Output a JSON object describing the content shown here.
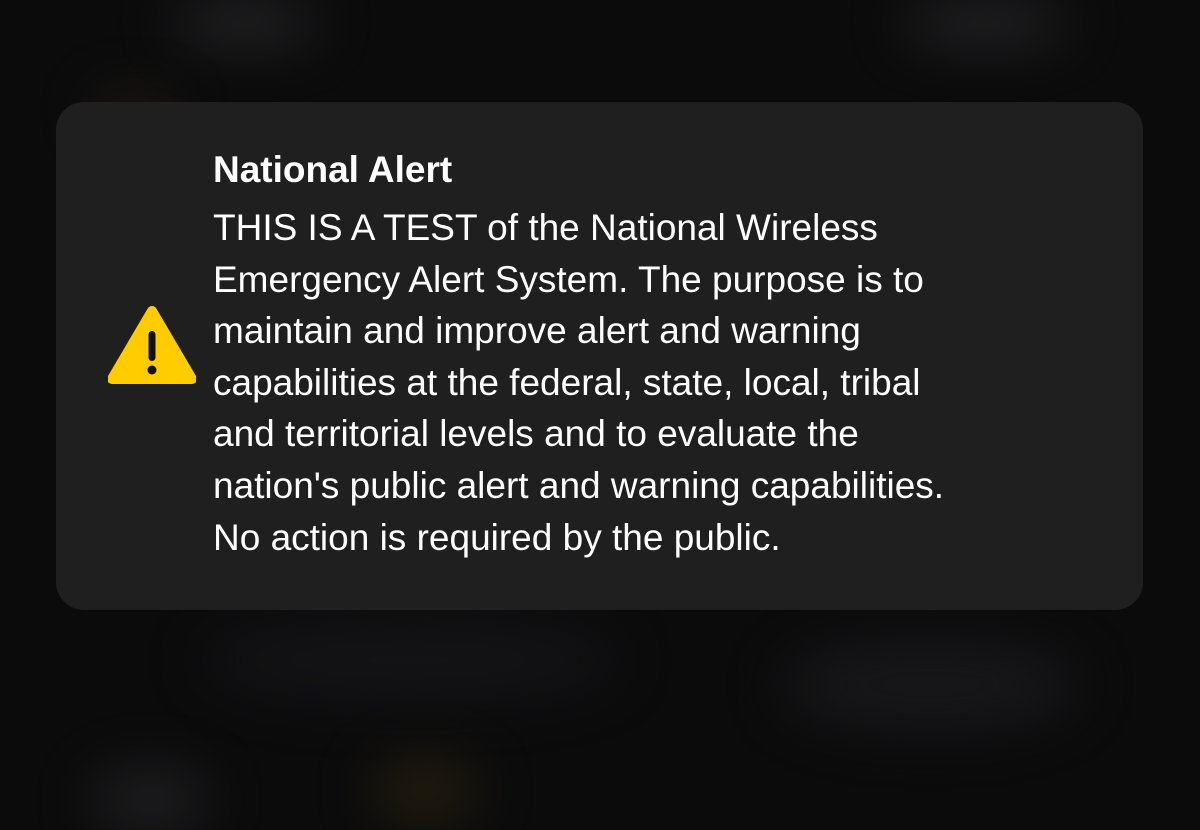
{
  "alert": {
    "icon": "warning-triangle-icon",
    "icon_color": "#FFCC00",
    "title": "National Alert",
    "body_lines": [
      "THIS IS A TEST of the National Wireless",
      "Emergency Alert System. The purpose is to",
      "maintain and improve alert and warning",
      "capabilities at the federal, state, local, tribal",
      "and territorial levels and to evaluate the",
      "nation's public alert and warning capabilities.",
      "No action is required by the public."
    ]
  }
}
